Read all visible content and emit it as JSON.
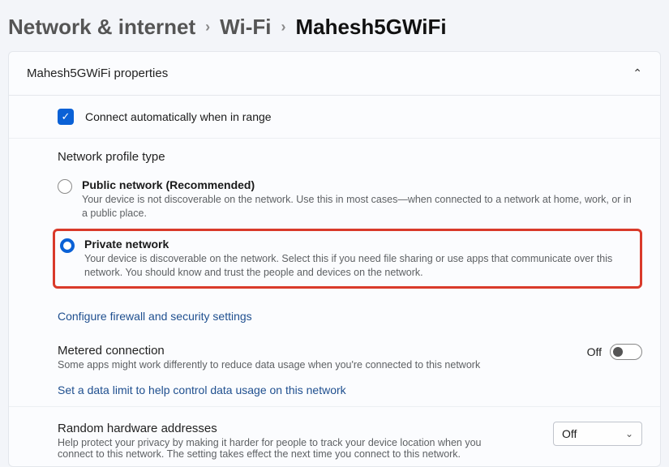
{
  "breadcrumb": {
    "root": "Network & internet",
    "mid": "Wi-Fi",
    "current": "Mahesh5GWiFi"
  },
  "panel": {
    "title": "Mahesh5GWiFi properties"
  },
  "auto_connect": {
    "label": "Connect automatically when in range",
    "checked": true
  },
  "profile": {
    "heading": "Network profile type",
    "public": {
      "label": "Public network (Recommended)",
      "desc": "Your device is not discoverable on the network. Use this in most cases—when connected to a network at home, work, or in a public place."
    },
    "private": {
      "label": "Private network",
      "desc": "Your device is discoverable on the network. Select this if you need file sharing or use apps that communicate over this network. You should know and trust the people and devices on the network."
    },
    "selected": "private",
    "firewall_link": "Configure firewall and security settings"
  },
  "metered": {
    "title": "Metered connection",
    "desc": "Some apps might work differently to reduce data usage when you're connected to this network",
    "state_label": "Off",
    "data_limit_link": "Set a data limit to help control data usage on this network"
  },
  "random_hw": {
    "title": "Random hardware addresses",
    "desc": "Help protect your privacy by making it harder for people to track your device location when you connect to this network. The setting takes effect the next time you connect to this network.",
    "value": "Off"
  }
}
